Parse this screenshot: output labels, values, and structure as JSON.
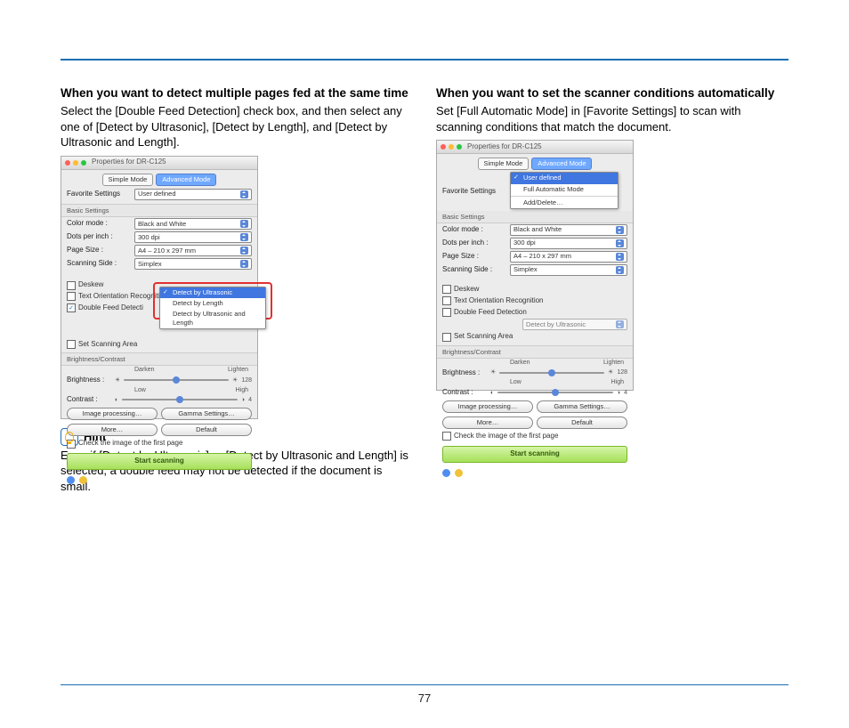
{
  "page_number": "77",
  "left": {
    "heading": "When you want to detect multiple pages fed at the same time",
    "body": "Select the [Double Feed Detection] check box, and then select any one of [Detect by Ultrasonic], [Detect by Length], and [Detect by Ultrasonic and Length].",
    "hint_label": "Hint",
    "hint_body": "Even if [Detect by Ultrasonic] or [Detect by Ultrasonic and Length] is selected, a double feed may not be detected if the document is small."
  },
  "right": {
    "heading": "When you want to set the scanner conditions automatically",
    "body": "Set [Full Automatic Mode] in [Favorite Settings] to scan with scanning conditions that match the document."
  },
  "shot_common": {
    "window_title": "Properties for DR-C125",
    "tab_simple": "Simple Mode",
    "tab_advanced": "Advanced Mode",
    "fav_label": "Favorite Settings",
    "fav_value": "User defined",
    "basic_label": "Basic Settings",
    "color_label": "Color mode :",
    "color_value": "Black and White",
    "dpi_label": "Dots per inch :",
    "dpi_value": "300 dpi",
    "page_label": "Page Size :",
    "page_value": "A4 – 210 x 297 mm",
    "side_label": "Scanning Side :",
    "side_value": "Simplex",
    "deskew": "Deskew",
    "text_orient": "Text Orientation Recognition",
    "double_feed": "Double Feed Detecti",
    "double_feed_full": "Double Feed Detection",
    "set_area": "Set Scanning Area",
    "bc_label": "Brightness/Contrast",
    "darken": "Darken",
    "lighten": "Lighten",
    "brightness": "Brightness :",
    "brightness_val": "128",
    "low": "Low",
    "high": "High",
    "contrast": "Contrast :",
    "contrast_val": "4",
    "img_proc": "Image processing…",
    "gamma": "Gamma Settings…",
    "more": "More…",
    "default": "Default",
    "check_first": "Check the image of the first page",
    "start": "Start scanning",
    "detect_ultra": "Detect by Ultrasonic",
    "detect_len": "Detect by Length",
    "detect_both": "Detect by Ultrasonic and Length",
    "detect_ultra_select": "Detect by Ultrasonic"
  },
  "shot_right_extra": {
    "menu_user": "User defined",
    "menu_auto": "Full Automatic Mode",
    "menu_add": "Add/Delete…"
  }
}
